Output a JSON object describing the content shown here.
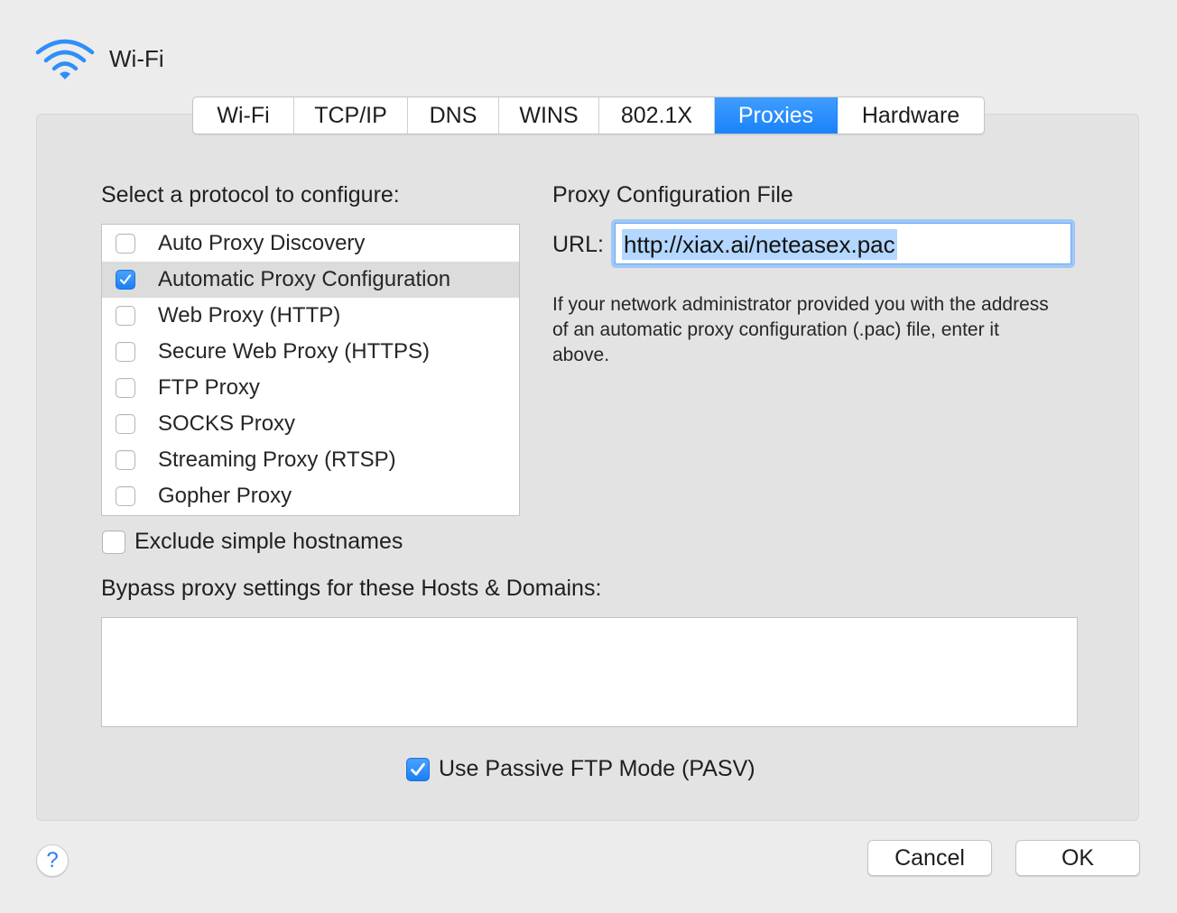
{
  "header": {
    "title": "Wi-Fi"
  },
  "tabs": [
    {
      "label": "Wi-Fi",
      "active": false
    },
    {
      "label": "TCP/IP",
      "active": false
    },
    {
      "label": "DNS",
      "active": false
    },
    {
      "label": "WINS",
      "active": false
    },
    {
      "label": "802.1X",
      "active": false
    },
    {
      "label": "Proxies",
      "active": true
    },
    {
      "label": "Hardware",
      "active": false
    }
  ],
  "protocols": {
    "heading": "Select a protocol to configure:",
    "items": [
      {
        "label": "Auto Proxy Discovery",
        "checked": false,
        "selected": false
      },
      {
        "label": "Automatic Proxy Configuration",
        "checked": true,
        "selected": true
      },
      {
        "label": "Web Proxy (HTTP)",
        "checked": false,
        "selected": false
      },
      {
        "label": "Secure Web Proxy (HTTPS)",
        "checked": false,
        "selected": false
      },
      {
        "label": "FTP Proxy",
        "checked": false,
        "selected": false
      },
      {
        "label": "SOCKS Proxy",
        "checked": false,
        "selected": false
      },
      {
        "label": "Streaming Proxy (RTSP)",
        "checked": false,
        "selected": false
      },
      {
        "label": "Gopher Proxy",
        "checked": false,
        "selected": false
      }
    ]
  },
  "config": {
    "heading": "Proxy Configuration File",
    "url_label": "URL:",
    "url_value": "http://xiax.ai/neteasex.pac",
    "help_text": "If your network administrator provided you with the address of an automatic proxy configuration (.pac) file, enter it above."
  },
  "exclude": {
    "label": "Exclude simple hostnames",
    "checked": false
  },
  "bypass": {
    "label": "Bypass proxy settings for these Hosts & Domains:",
    "value": ""
  },
  "pasv": {
    "label": "Use Passive FTP Mode (PASV)",
    "checked": true
  },
  "buttons": {
    "help": "?",
    "cancel": "Cancel",
    "ok": "OK"
  },
  "colors": {
    "accent": "#1a82fb",
    "panel": "#e3e3e3",
    "window": "#ececec"
  }
}
